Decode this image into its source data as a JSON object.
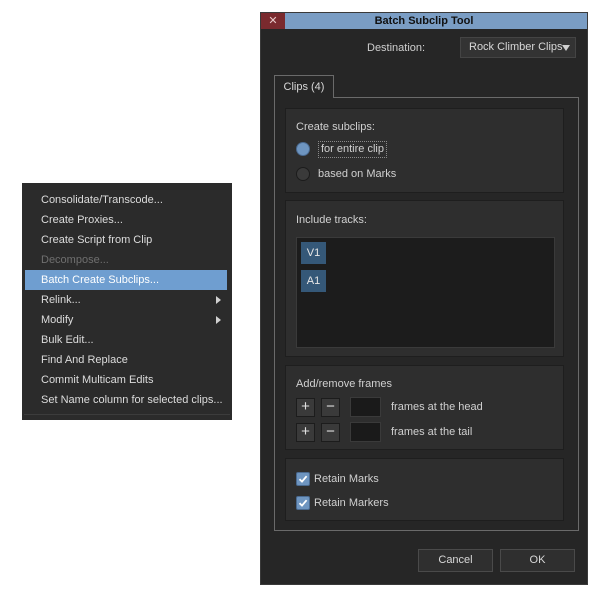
{
  "context_menu": {
    "items": [
      {
        "label": "Consolidate/Transcode...",
        "state": "normal",
        "submenu": false
      },
      {
        "label": "Create Proxies...",
        "state": "normal",
        "submenu": false
      },
      {
        "label": "Create Script from Clip",
        "state": "normal",
        "submenu": false
      },
      {
        "label": "Decompose...",
        "state": "disabled",
        "submenu": false
      },
      {
        "label": "Batch Create Subclips...",
        "state": "highlighted",
        "submenu": false
      },
      {
        "label": "Relink...",
        "state": "normal",
        "submenu": true
      },
      {
        "label": "Modify",
        "state": "normal",
        "submenu": true
      },
      {
        "label": "Bulk Edit...",
        "state": "normal",
        "submenu": false
      },
      {
        "label": "Find And Replace",
        "state": "normal",
        "submenu": false
      },
      {
        "label": "Commit Multicam Edits",
        "state": "normal",
        "submenu": false
      },
      {
        "label": "Set Name column for selected clips...",
        "state": "normal",
        "submenu": false
      }
    ]
  },
  "dialog": {
    "title": "Batch Subclip Tool",
    "close_glyph": "✕",
    "destination": {
      "label": "Destination:",
      "value": "Rock Climber Clips"
    },
    "tab": {
      "label": "Clips (4)"
    },
    "create_subclips": {
      "label": "Create subclips:",
      "options": [
        {
          "label": "for entire clip",
          "selected": true
        },
        {
          "label": "based on Marks",
          "selected": false
        }
      ]
    },
    "include_tracks": {
      "label": "Include tracks:",
      "tracks": [
        "V1",
        "A1"
      ]
    },
    "frames": {
      "label": "Add/remove frames",
      "plus": "+",
      "minus": "−",
      "head": {
        "value": "",
        "label": "frames at the head"
      },
      "tail": {
        "value": "",
        "label": "frames at the tail"
      }
    },
    "options": {
      "retain_marks": {
        "label": "Retain Marks",
        "checked": true
      },
      "retain_markers": {
        "label": "Retain Markers",
        "checked": true
      }
    },
    "buttons": {
      "cancel": "Cancel",
      "ok": "OK"
    }
  },
  "colors": {
    "accent": "#6e95c0",
    "menu_highlight": "#6f9ed0",
    "titlebar": "#7a9dc4",
    "close": "#7a2a2e",
    "track_chip": "#355878",
    "panel": "#262626"
  }
}
